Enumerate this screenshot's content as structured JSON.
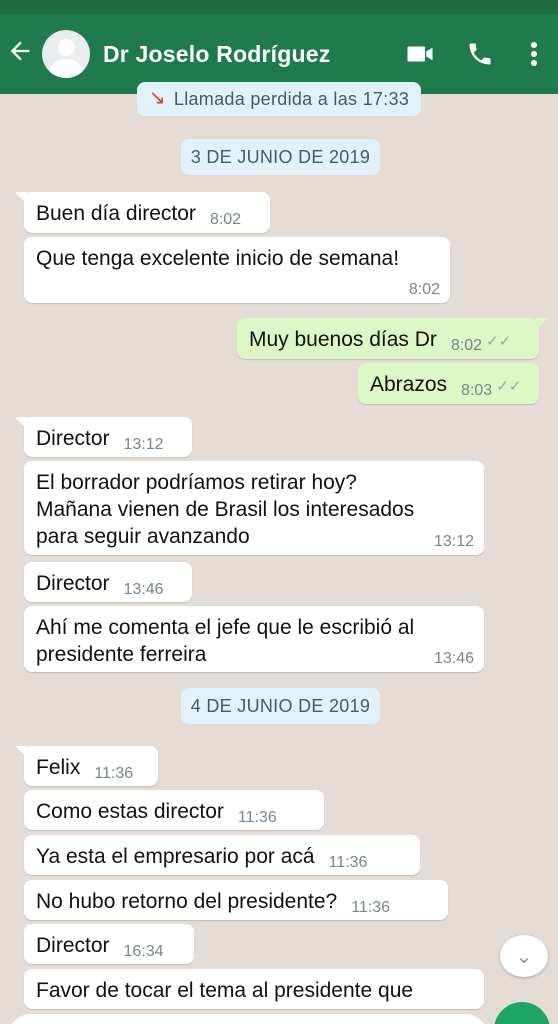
{
  "header": {
    "contact_name": "Dr Joselo Rodríguez",
    "icons": [
      "back-arrow-icon",
      "avatar",
      "video-call-icon",
      "phone-icon",
      "more-vert-icon"
    ],
    "color": "#1f7a4d"
  },
  "system_message": "Llamada perdida a las 17:33",
  "date_dividers": [
    "3 DE JUNIO DE 2019",
    "4 DE JUNIO DE 2019"
  ],
  "messages": [
    {
      "dir": "in",
      "text": "Buen día director",
      "time": "8:02"
    },
    {
      "dir": "in",
      "text": "Que tenga excelente inicio de semana!",
      "time": "8:02"
    },
    {
      "dir": "out",
      "text": "Muy buenos días Dr",
      "time": "8:02"
    },
    {
      "dir": "out",
      "text": "Abrazos",
      "time": "8:03"
    },
    {
      "dir": "in",
      "text": "Director",
      "time": "13:12"
    },
    {
      "dir": "in",
      "lines": [
        "El borrador podríamos retirar hoy?",
        "Mañana vienen de Brasil los interesados",
        "para seguir avanzando"
      ],
      "time": "13:12"
    },
    {
      "dir": "in",
      "text": "Director",
      "time": "13:46"
    },
    {
      "dir": "in",
      "lines": [
        "Ahí me comenta el jefe que le escribió al",
        "presidente ferreira"
      ],
      "time": "13:46"
    },
    {
      "dir": "in",
      "text": "Felix",
      "time": "11:36"
    },
    {
      "dir": "in",
      "text": "Como estas director",
      "time": "11:36"
    },
    {
      "dir": "in",
      "text": "Ya esta el empresario por acá",
      "time": "11:36"
    },
    {
      "dir": "in",
      "text": "No hubo retorno del presidente?",
      "time": "11:36"
    },
    {
      "dir": "in",
      "text": "Director",
      "time": "16:34"
    },
    {
      "dir": "in",
      "text": "Favor de tocar el tema al presidente que",
      "time": ""
    }
  ],
  "colors": {
    "incoming": "#ffffff",
    "outgoing": "#dcf8c6",
    "background": "#e5ddd5",
    "date_pill": "#e1f2fb"
  }
}
